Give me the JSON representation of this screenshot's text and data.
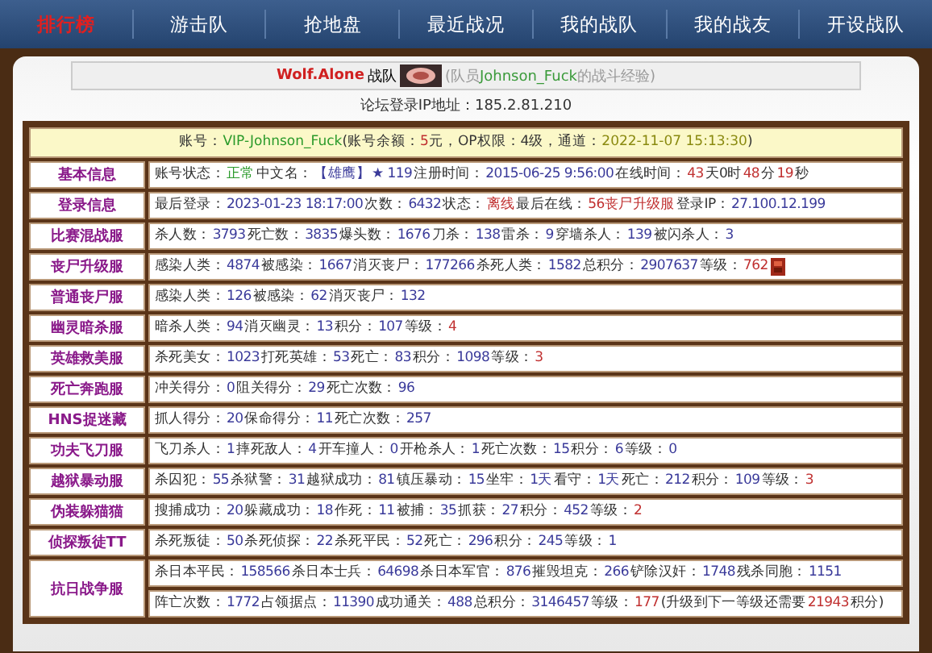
{
  "nav": [
    {
      "label": "排行榜",
      "selected": true
    },
    {
      "label": "游击队",
      "selected": false
    },
    {
      "label": "抢地盘",
      "selected": false
    },
    {
      "label": "最近战况",
      "selected": false
    },
    {
      "label": "我的战队",
      "selected": false
    },
    {
      "label": "我的战友",
      "selected": false
    },
    {
      "label": "开设战队",
      "selected": false
    }
  ],
  "header": {
    "team": "Wolf.Alone",
    "team_suffix": "战队",
    "member_note": [
      {
        "kind": "text",
        "t": "(队员"
      },
      {
        "kind": "ok",
        "t": "Johnson_Fuck"
      },
      {
        "kind": "text",
        "t": "的战斗经验)"
      }
    ],
    "ip": "论坛登录IP地址：185.2.81.210"
  },
  "account": [
    {
      "kind": "text",
      "t": "账号："
    },
    {
      "kind": "ok",
      "t": "VIP-Johnson_Fuck"
    },
    {
      "kind": "text",
      "t": "(账号余额："
    },
    {
      "kind": "warn",
      "t": "5"
    },
    {
      "kind": "text",
      "t": "元，OP权限：4级，通道："
    },
    {
      "kind": "date",
      "t": "2022-11-07 15:13:30"
    },
    {
      "kind": "text",
      "t": ")"
    }
  ],
  "rows": [
    {
      "label": "基本信息",
      "lines": [
        [
          {
            "kind": "text",
            "t": "账号状态："
          },
          {
            "kind": "ok",
            "t": "正常"
          },
          {
            "kind": "text",
            "t": "中文名："
          },
          {
            "kind": "num",
            "t": "【雄鹰】"
          },
          {
            "kind": "num",
            "t": "★ 119"
          },
          {
            "kind": "text",
            "t": "注册时间："
          },
          {
            "kind": "num",
            "t": "2015-06-25 9:56:00"
          },
          {
            "kind": "text",
            "t": "在线时间："
          },
          {
            "kind": "warn",
            "t": "43"
          },
          {
            "kind": "text",
            "t": "天0时"
          },
          {
            "kind": "warn",
            "t": "48"
          },
          {
            "kind": "text",
            "t": "分"
          },
          {
            "kind": "warn",
            "t": "19"
          },
          {
            "kind": "text",
            "t": "秒"
          }
        ]
      ]
    },
    {
      "label": "登录信息",
      "lines": [
        [
          {
            "kind": "text",
            "t": "最后登录："
          },
          {
            "kind": "num",
            "t": "2023-01-23 18:17:00"
          },
          {
            "kind": "text",
            "t": "次数："
          },
          {
            "kind": "num",
            "t": "6432"
          },
          {
            "kind": "text",
            "t": "状态："
          },
          {
            "kind": "warn",
            "t": "离线"
          },
          {
            "kind": "text",
            "t": "最后在线："
          },
          {
            "kind": "warn",
            "t": "56丧尸升级服"
          },
          {
            "kind": "text",
            "t": "登录IP："
          },
          {
            "kind": "num",
            "t": "27.100.12.199"
          }
        ]
      ]
    },
    {
      "label": "比赛混战服",
      "lines": [
        [
          {
            "kind": "text",
            "t": "杀人数："
          },
          {
            "kind": "num",
            "t": "3793"
          },
          {
            "kind": "text",
            "t": "死亡数："
          },
          {
            "kind": "num",
            "t": "3835"
          },
          {
            "kind": "text",
            "t": "爆头数："
          },
          {
            "kind": "num",
            "t": "1676"
          },
          {
            "kind": "text",
            "t": "刀杀："
          },
          {
            "kind": "num",
            "t": "138"
          },
          {
            "kind": "text",
            "t": "雷杀："
          },
          {
            "kind": "num",
            "t": "9"
          },
          {
            "kind": "text",
            "t": "穿墙杀人："
          },
          {
            "kind": "num",
            "t": "139"
          },
          {
            "kind": "text",
            "t": "被闪杀人："
          },
          {
            "kind": "num",
            "t": "3"
          }
        ]
      ]
    },
    {
      "label": "丧尸升级服",
      "lines": [
        [
          {
            "kind": "text",
            "t": "感染人类："
          },
          {
            "kind": "num",
            "t": "4874"
          },
          {
            "kind": "text",
            "t": "被感染："
          },
          {
            "kind": "num",
            "t": "1667"
          },
          {
            "kind": "text",
            "t": "消灭丧尸："
          },
          {
            "kind": "num",
            "t": "177266"
          },
          {
            "kind": "text",
            "t": "杀死人类："
          },
          {
            "kind": "num",
            "t": "1582"
          },
          {
            "kind": "text",
            "t": "总积分："
          },
          {
            "kind": "num",
            "t": "2907637"
          },
          {
            "kind": "text",
            "t": "等级："
          },
          {
            "kind": "warn",
            "t": "762"
          },
          {
            "kind": "rank"
          }
        ]
      ]
    },
    {
      "label": "普通丧尸服",
      "lines": [
        [
          {
            "kind": "text",
            "t": "感染人类："
          },
          {
            "kind": "num",
            "t": "126"
          },
          {
            "kind": "text",
            "t": "被感染："
          },
          {
            "kind": "num",
            "t": "62"
          },
          {
            "kind": "text",
            "t": "消灭丧尸："
          },
          {
            "kind": "num",
            "t": "132"
          }
        ]
      ]
    },
    {
      "label": "幽灵暗杀服",
      "lines": [
        [
          {
            "kind": "text",
            "t": "暗杀人类："
          },
          {
            "kind": "num",
            "t": "94"
          },
          {
            "kind": "text",
            "t": "消灭幽灵："
          },
          {
            "kind": "num",
            "t": "13"
          },
          {
            "kind": "text",
            "t": "积分："
          },
          {
            "kind": "num",
            "t": "107"
          },
          {
            "kind": "text",
            "t": "等级："
          },
          {
            "kind": "warn",
            "t": "4"
          }
        ]
      ]
    },
    {
      "label": "英雄救美服",
      "lines": [
        [
          {
            "kind": "text",
            "t": "杀死美女："
          },
          {
            "kind": "num",
            "t": "1023"
          },
          {
            "kind": "text",
            "t": "打死英雄："
          },
          {
            "kind": "num",
            "t": "53"
          },
          {
            "kind": "text",
            "t": "死亡："
          },
          {
            "kind": "num",
            "t": "83"
          },
          {
            "kind": "text",
            "t": "积分："
          },
          {
            "kind": "num",
            "t": "1098"
          },
          {
            "kind": "text",
            "t": "等级："
          },
          {
            "kind": "warn",
            "t": "3"
          }
        ]
      ]
    },
    {
      "label": "死亡奔跑服",
      "lines": [
        [
          {
            "kind": "text",
            "t": "冲关得分："
          },
          {
            "kind": "num",
            "t": "0"
          },
          {
            "kind": "text",
            "t": "阻关得分："
          },
          {
            "kind": "num",
            "t": "29"
          },
          {
            "kind": "text",
            "t": "死亡次数："
          },
          {
            "kind": "num",
            "t": "96"
          }
        ]
      ]
    },
    {
      "label": "HNS捉迷藏",
      "lines": [
        [
          {
            "kind": "text",
            "t": "抓人得分："
          },
          {
            "kind": "num",
            "t": "20"
          },
          {
            "kind": "text",
            "t": "保命得分："
          },
          {
            "kind": "num",
            "t": "11"
          },
          {
            "kind": "text",
            "t": "死亡次数："
          },
          {
            "kind": "num",
            "t": "257"
          }
        ]
      ]
    },
    {
      "label": "功夫飞刀服",
      "lines": [
        [
          {
            "kind": "text",
            "t": "飞刀杀人："
          },
          {
            "kind": "num",
            "t": "1"
          },
          {
            "kind": "text",
            "t": "摔死敌人："
          },
          {
            "kind": "num",
            "t": "4"
          },
          {
            "kind": "text",
            "t": "开车撞人："
          },
          {
            "kind": "num",
            "t": "0"
          },
          {
            "kind": "text",
            "t": "开枪杀人："
          },
          {
            "kind": "num",
            "t": "1"
          },
          {
            "kind": "text",
            "t": "死亡次数："
          },
          {
            "kind": "num",
            "t": "15"
          },
          {
            "kind": "text",
            "t": "积分："
          },
          {
            "kind": "num",
            "t": "6"
          },
          {
            "kind": "text",
            "t": "等级："
          },
          {
            "kind": "num",
            "t": "0"
          }
        ]
      ]
    },
    {
      "label": "越狱暴动服",
      "lines": [
        [
          {
            "kind": "text",
            "t": "杀囚犯："
          },
          {
            "kind": "num",
            "t": "55"
          },
          {
            "kind": "text",
            "t": "杀狱警："
          },
          {
            "kind": "num",
            "t": "31"
          },
          {
            "kind": "text",
            "t": "越狱成功："
          },
          {
            "kind": "num",
            "t": "81"
          },
          {
            "kind": "text",
            "t": "镇压暴动："
          },
          {
            "kind": "num",
            "t": "15"
          },
          {
            "kind": "text",
            "t": "坐牢："
          },
          {
            "kind": "num",
            "t": "1天"
          },
          {
            "kind": "text",
            "t": "看守："
          },
          {
            "kind": "num",
            "t": "1天"
          },
          {
            "kind": "text",
            "t": "死亡："
          },
          {
            "kind": "num",
            "t": "212"
          },
          {
            "kind": "text",
            "t": "积分："
          },
          {
            "kind": "num",
            "t": "109"
          },
          {
            "kind": "text",
            "t": "等级："
          },
          {
            "kind": "warn",
            "t": "3"
          }
        ]
      ]
    },
    {
      "label": "伪装躲猫猫",
      "lines": [
        [
          {
            "kind": "text",
            "t": "搜捕成功："
          },
          {
            "kind": "num",
            "t": "20"
          },
          {
            "kind": "text",
            "t": "躲藏成功："
          },
          {
            "kind": "num",
            "t": "18"
          },
          {
            "kind": "text",
            "t": "作死："
          },
          {
            "kind": "num",
            "t": "11"
          },
          {
            "kind": "text",
            "t": "被捕："
          },
          {
            "kind": "num",
            "t": "35"
          },
          {
            "kind": "text",
            "t": "抓获："
          },
          {
            "kind": "num",
            "t": "27"
          },
          {
            "kind": "text",
            "t": "积分："
          },
          {
            "kind": "num",
            "t": "452"
          },
          {
            "kind": "text",
            "t": "等级："
          },
          {
            "kind": "warn",
            "t": "2"
          }
        ]
      ]
    },
    {
      "label": "侦探叛徒TT",
      "lines": [
        [
          {
            "kind": "text",
            "t": "杀死叛徒："
          },
          {
            "kind": "num",
            "t": "50"
          },
          {
            "kind": "text",
            "t": "杀死侦探："
          },
          {
            "kind": "num",
            "t": "22"
          },
          {
            "kind": "text",
            "t": "杀死平民："
          },
          {
            "kind": "num",
            "t": "52"
          },
          {
            "kind": "text",
            "t": "死亡："
          },
          {
            "kind": "num",
            "t": "296"
          },
          {
            "kind": "text",
            "t": "积分："
          },
          {
            "kind": "num",
            "t": "245"
          },
          {
            "kind": "text",
            "t": "等级："
          },
          {
            "kind": "num",
            "t": "1"
          }
        ]
      ]
    },
    {
      "label": "抗日战争服",
      "lines": [
        [
          {
            "kind": "text",
            "t": "杀日本平民："
          },
          {
            "kind": "num",
            "t": "158566"
          },
          {
            "kind": "text",
            "t": "杀日本士兵："
          },
          {
            "kind": "num",
            "t": "64698"
          },
          {
            "kind": "text",
            "t": "杀日本军官："
          },
          {
            "kind": "num",
            "t": "876"
          },
          {
            "kind": "text",
            "t": "摧毁坦克："
          },
          {
            "kind": "num",
            "t": "266"
          },
          {
            "kind": "text",
            "t": "铲除汉奸："
          },
          {
            "kind": "num",
            "t": "1748"
          },
          {
            "kind": "text",
            "t": "残杀同胞："
          },
          {
            "kind": "num",
            "t": "1151"
          }
        ],
        [
          {
            "kind": "text",
            "t": "阵亡次数："
          },
          {
            "kind": "num",
            "t": "1772"
          },
          {
            "kind": "text",
            "t": "占领据点："
          },
          {
            "kind": "num",
            "t": "11390"
          },
          {
            "kind": "text",
            "t": "成功通关："
          },
          {
            "kind": "num",
            "t": "488"
          },
          {
            "kind": "text",
            "t": "总积分："
          },
          {
            "kind": "num",
            "t": "3146457"
          },
          {
            "kind": "text",
            "t": "等级："
          },
          {
            "kind": "warn",
            "t": "177"
          },
          {
            "kind": "text",
            "t": "(升级到下一等级还需要"
          },
          {
            "kind": "warn",
            "t": "21943"
          },
          {
            "kind": "text",
            "t": "积分)"
          }
        ]
      ]
    }
  ]
}
